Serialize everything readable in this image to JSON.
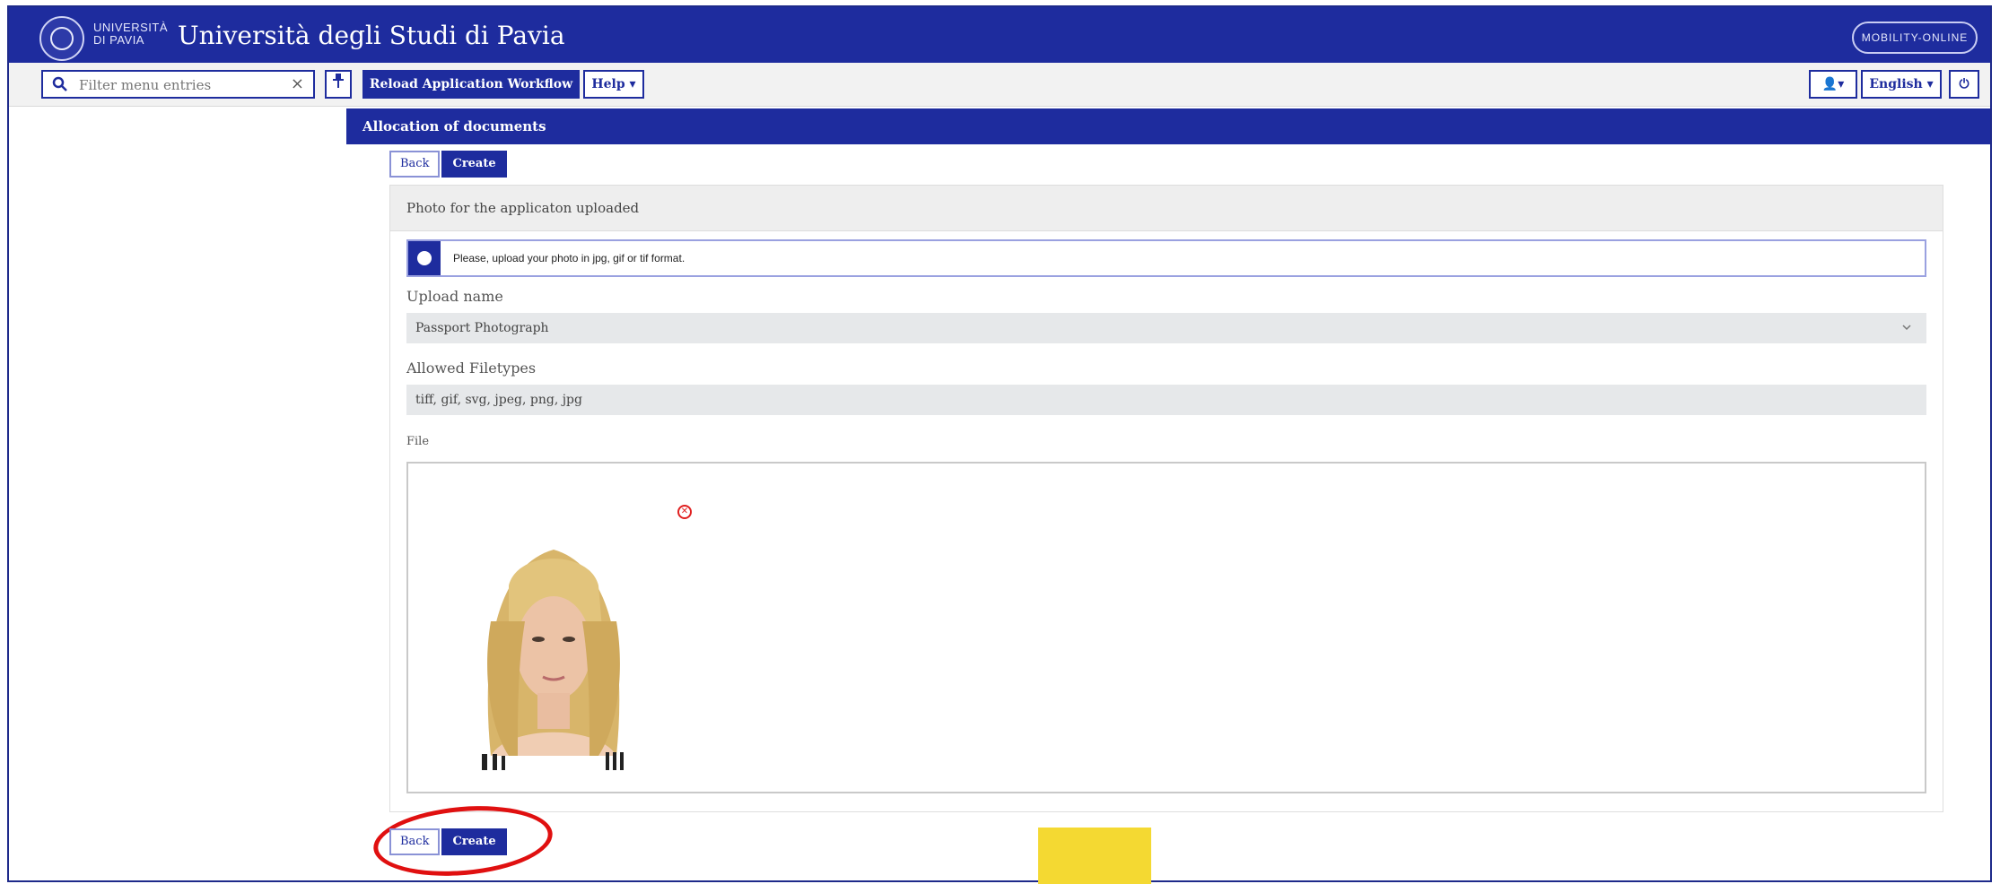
{
  "header": {
    "logo_text": "UNIVERSITÀ DI PAVIA",
    "title": "Università degli Studi di Pavia",
    "partner_logo_text": "MOBILITY-ONLINE"
  },
  "toolbar": {
    "filter_placeholder": "Filter menu entries",
    "clear_label": "×",
    "reload_label": "Reload Application Workflow",
    "help_label": "Help ▾",
    "user_label": "👤▾",
    "language_label": "English ▾",
    "power_label": "⏻"
  },
  "main": {
    "section_title": "Allocation of documents",
    "top_back_label": "Back",
    "top_create_label": "Create",
    "card_title": "Photo for the applicaton uploaded",
    "info_text": "Please, upload your photo in jpg, gif or tif format.",
    "upload_name_label": "Upload name",
    "upload_name_value": "Passport Photograph",
    "allowed_filetypes_label": "Allowed Filetypes",
    "allowed_filetypes_value": "tiff, gif, svg, jpeg, png, jpg",
    "file_label": "File",
    "bottom_back_label": "Back",
    "bottom_create_label": "Create"
  },
  "colors": {
    "primary": "#1e2c9e",
    "highlight": "#e01010",
    "accent_block": "#f4d932"
  },
  "icons": {
    "search": "search-icon",
    "pin": "pin-icon",
    "info": "info-icon",
    "remove": "remove-file-icon",
    "chevron": "chevron-down-icon"
  }
}
